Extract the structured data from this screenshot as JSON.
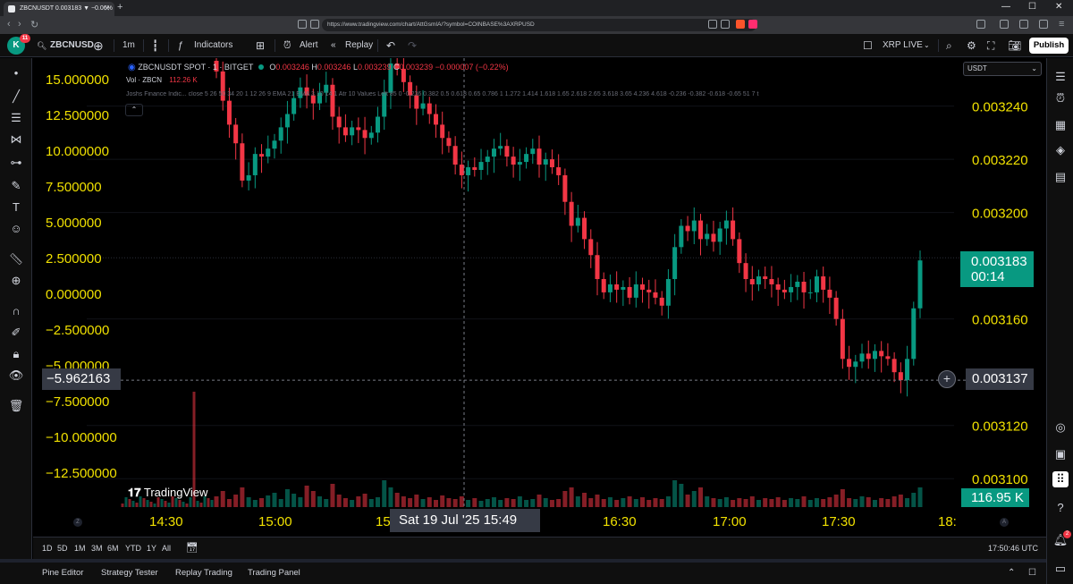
{
  "browser": {
    "tab_title": "ZBCNUSDT 0.003183 ▼ −0.06%",
    "url": "https://www.tradingview.com/chart/AttGsmIA/?symbol=COINBASE%3AXRPUSD"
  },
  "header": {
    "avatar_letter": "K",
    "avatar_badge": "11",
    "symbol": "ZBCNUSD",
    "interval": "1m",
    "indicators_label": "Indicators",
    "alert_label": "Alert",
    "replay_label": "Replay",
    "watch_label": "XRP LIVE",
    "publish_label": "Publish"
  },
  "legend": {
    "title": "ZBCNUSDT SPOT · 1 · BITGET",
    "o_label": "O",
    "o_value": "0.003246",
    "h_label": "H",
    "h_value": "0.003246",
    "l_label": "L",
    "l_value": "0.003239",
    "c_label": "C",
    "c_value": "0.003239",
    "change": "−0.000007 (−0.22%)",
    "vol_label": "Vol · ZBCN",
    "vol_value": "112.26 K",
    "indicator_line": "Joshs Finance Indic...   close 5 26 50 34 20 1 12 26 9 EMA 21 EMA 3 10 14 1 Atr 10 Values Left 85 0 -0.236 0.382 0.5 0.618 0.65 0.786 1 1.272 1.414 1.618 1.65 2.618 2.65 3.618 3.65 4.236 4.618 -0.236 -0.382 -0.618 -0.65 51 7 t"
  },
  "currency_select": "USDT",
  "price_axis": {
    "ticks": [
      "0.003240",
      "0.003220",
      "0.003200",
      "0.003160",
      "0.003120",
      "0.003100"
    ],
    "current_price": "0.003183",
    "countdown": "00:14",
    "crosshair_price": "0.003137",
    "volume_label": "116.95 K"
  },
  "osc_axis": {
    "ticks": [
      "15.000000",
      "12.500000",
      "10.000000",
      "7.500000",
      "5.000000",
      "2.500000",
      "0.000000",
      "−2.500000",
      "−5.000000",
      "−7.500000",
      "−10.000000",
      "−12.500000"
    ],
    "crosshair_value": "−5.962163"
  },
  "time_axis": {
    "ticks": [
      "14:30",
      "15:00",
      "15:",
      "16:30",
      "17:00",
      "17:30",
      "18:"
    ],
    "crosshair_time": "Sat 19 Jul '25   15:49"
  },
  "watermark": "TradingView",
  "range_bar": {
    "ranges": [
      "1D",
      "5D",
      "1M",
      "3M",
      "6M",
      "YTD",
      "1Y",
      "All"
    ],
    "clock": "17:50:46 UTC"
  },
  "bottom_tabs": [
    "Pine Editor",
    "Strategy Tester",
    "Replay Trading",
    "Trading Panel"
  ],
  "right_badge": "2",
  "colors": {
    "up": "#089981",
    "down": "#f23645",
    "axis_text": "#f0e000",
    "crosshair": "#787b86"
  },
  "chart_data": {
    "type": "candlestick",
    "interval": "1m",
    "y_range": [
      0.00309,
      0.003258
    ],
    "closes": [
      0.003253,
      0.003242,
      0.003233,
      0.003226,
      0.003212,
      0.003214,
      0.003222,
      0.003221,
      0.003224,
      0.003227,
      0.003232,
      0.003237,
      0.003243,
      0.003247,
      0.003244,
      0.003241,
      0.003245,
      0.003248,
      0.003236,
      0.003232,
      0.003229,
      0.003232,
      0.003231,
      0.003228,
      0.00323,
      0.003236,
      0.003245,
      0.003256,
      0.003254,
      0.003249,
      0.003244,
      0.003239,
      0.003241,
      0.003237,
      0.003233,
      0.003228,
      0.003225,
      0.003218,
      0.003214,
      0.003217,
      0.003216,
      0.003219,
      0.003221,
      0.003224,
      0.003225,
      0.003221,
      0.003218,
      0.003219,
      0.003222,
      0.003224,
      0.003218,
      0.00322,
      0.003217,
      0.003214,
      0.003204,
      0.003195,
      0.003198,
      0.00319,
      0.003184,
      0.003175,
      0.00317,
      0.003173,
      0.003171,
      0.003172,
      0.003168,
      0.003173,
      0.003171,
      0.00317,
      0.003168,
      0.003165,
      0.003175,
      0.003187,
      0.003195,
      0.003193,
      0.003197,
      0.00319,
      0.003192,
      0.003189,
      0.003194,
      0.003197,
      0.00319,
      0.003181,
      0.003175,
      0.003173,
      0.003176,
      0.003175,
      0.003173,
      0.003171,
      0.00317,
      0.003172,
      0.003174,
      0.00317,
      0.00317,
      0.003176,
      0.003171,
      0.003168,
      0.00316,
      0.003145,
      0.003142,
      0.003144,
      0.003147,
      0.003145,
      0.003148,
      0.003146,
      0.003145,
      0.00314,
      0.003137,
      0.003145,
      0.003164,
      0.003182
    ],
    "volumes": [
      12,
      18,
      9,
      14,
      22,
      11,
      8,
      10,
      13,
      16,
      9,
      20,
      15,
      11,
      24,
      18,
      12,
      9,
      26,
      14,
      10,
      8,
      12,
      15,
      9,
      11,
      30,
      22,
      16,
      12,
      10,
      14,
      9,
      11,
      8,
      13,
      10,
      9,
      12,
      8,
      10,
      7,
      9,
      11,
      8,
      10,
      9,
      12,
      8,
      9,
      14,
      10,
      8,
      9,
      18,
      22,
      12,
      16,
      10,
      14,
      9,
      11,
      8,
      10,
      12,
      9,
      11,
      8,
      10,
      9,
      12,
      30,
      26,
      14,
      18,
      22,
      12,
      10,
      9,
      11,
      8,
      10,
      9,
      12,
      8,
      10,
      9,
      11,
      8,
      10,
      9,
      12,
      8,
      10,
      9,
      11,
      14,
      20,
      10,
      9,
      12,
      11,
      8,
      10,
      9,
      12,
      14,
      10,
      16,
      22
    ]
  }
}
